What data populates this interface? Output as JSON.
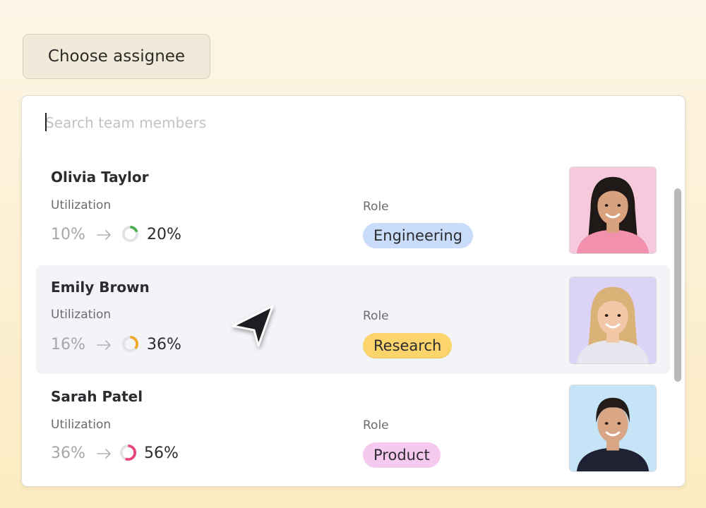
{
  "header": {
    "assign_button_label": "Choose assignee"
  },
  "search": {
    "placeholder": "Search team members",
    "value": ""
  },
  "labels": {
    "utilization": "Utilization",
    "role": "Role"
  },
  "members": [
    {
      "name": "Olivia Taylor",
      "utilization_from": "10%",
      "utilization_to": "20%",
      "utilization_to_fraction": 0.2,
      "donut_color": "#4cae4c",
      "role": "Engineering",
      "role_bg": "#c9dcf9",
      "avatar_bg": "#f7c9dc",
      "avatar_icon": "woman-portrait-icon",
      "hovered": false
    },
    {
      "name": "Emily Brown",
      "utilization_from": "16%",
      "utilization_to": "36%",
      "utilization_to_fraction": 0.36,
      "donut_color": "#f0a92c",
      "role": "Research",
      "role_bg": "#fbd46b",
      "avatar_bg": "#dcd4f6",
      "avatar_icon": "woman-portrait-icon",
      "hovered": true
    },
    {
      "name": "Sarah Patel",
      "utilization_from": "36%",
      "utilization_to": "56%",
      "utilization_to_fraction": 0.56,
      "donut_color": "#e8477a",
      "role": "Product",
      "role_bg": "#f6c9ef",
      "avatar_bg": "#c5e4f7",
      "avatar_icon": "woman-portrait-icon",
      "hovered": false
    }
  ],
  "colors": {
    "panel_bg": "#ffffff",
    "hover_row_bg": "#f3f4f8",
    "button_bg": "#f1e9da",
    "donut_track": "#e2e2e5"
  }
}
